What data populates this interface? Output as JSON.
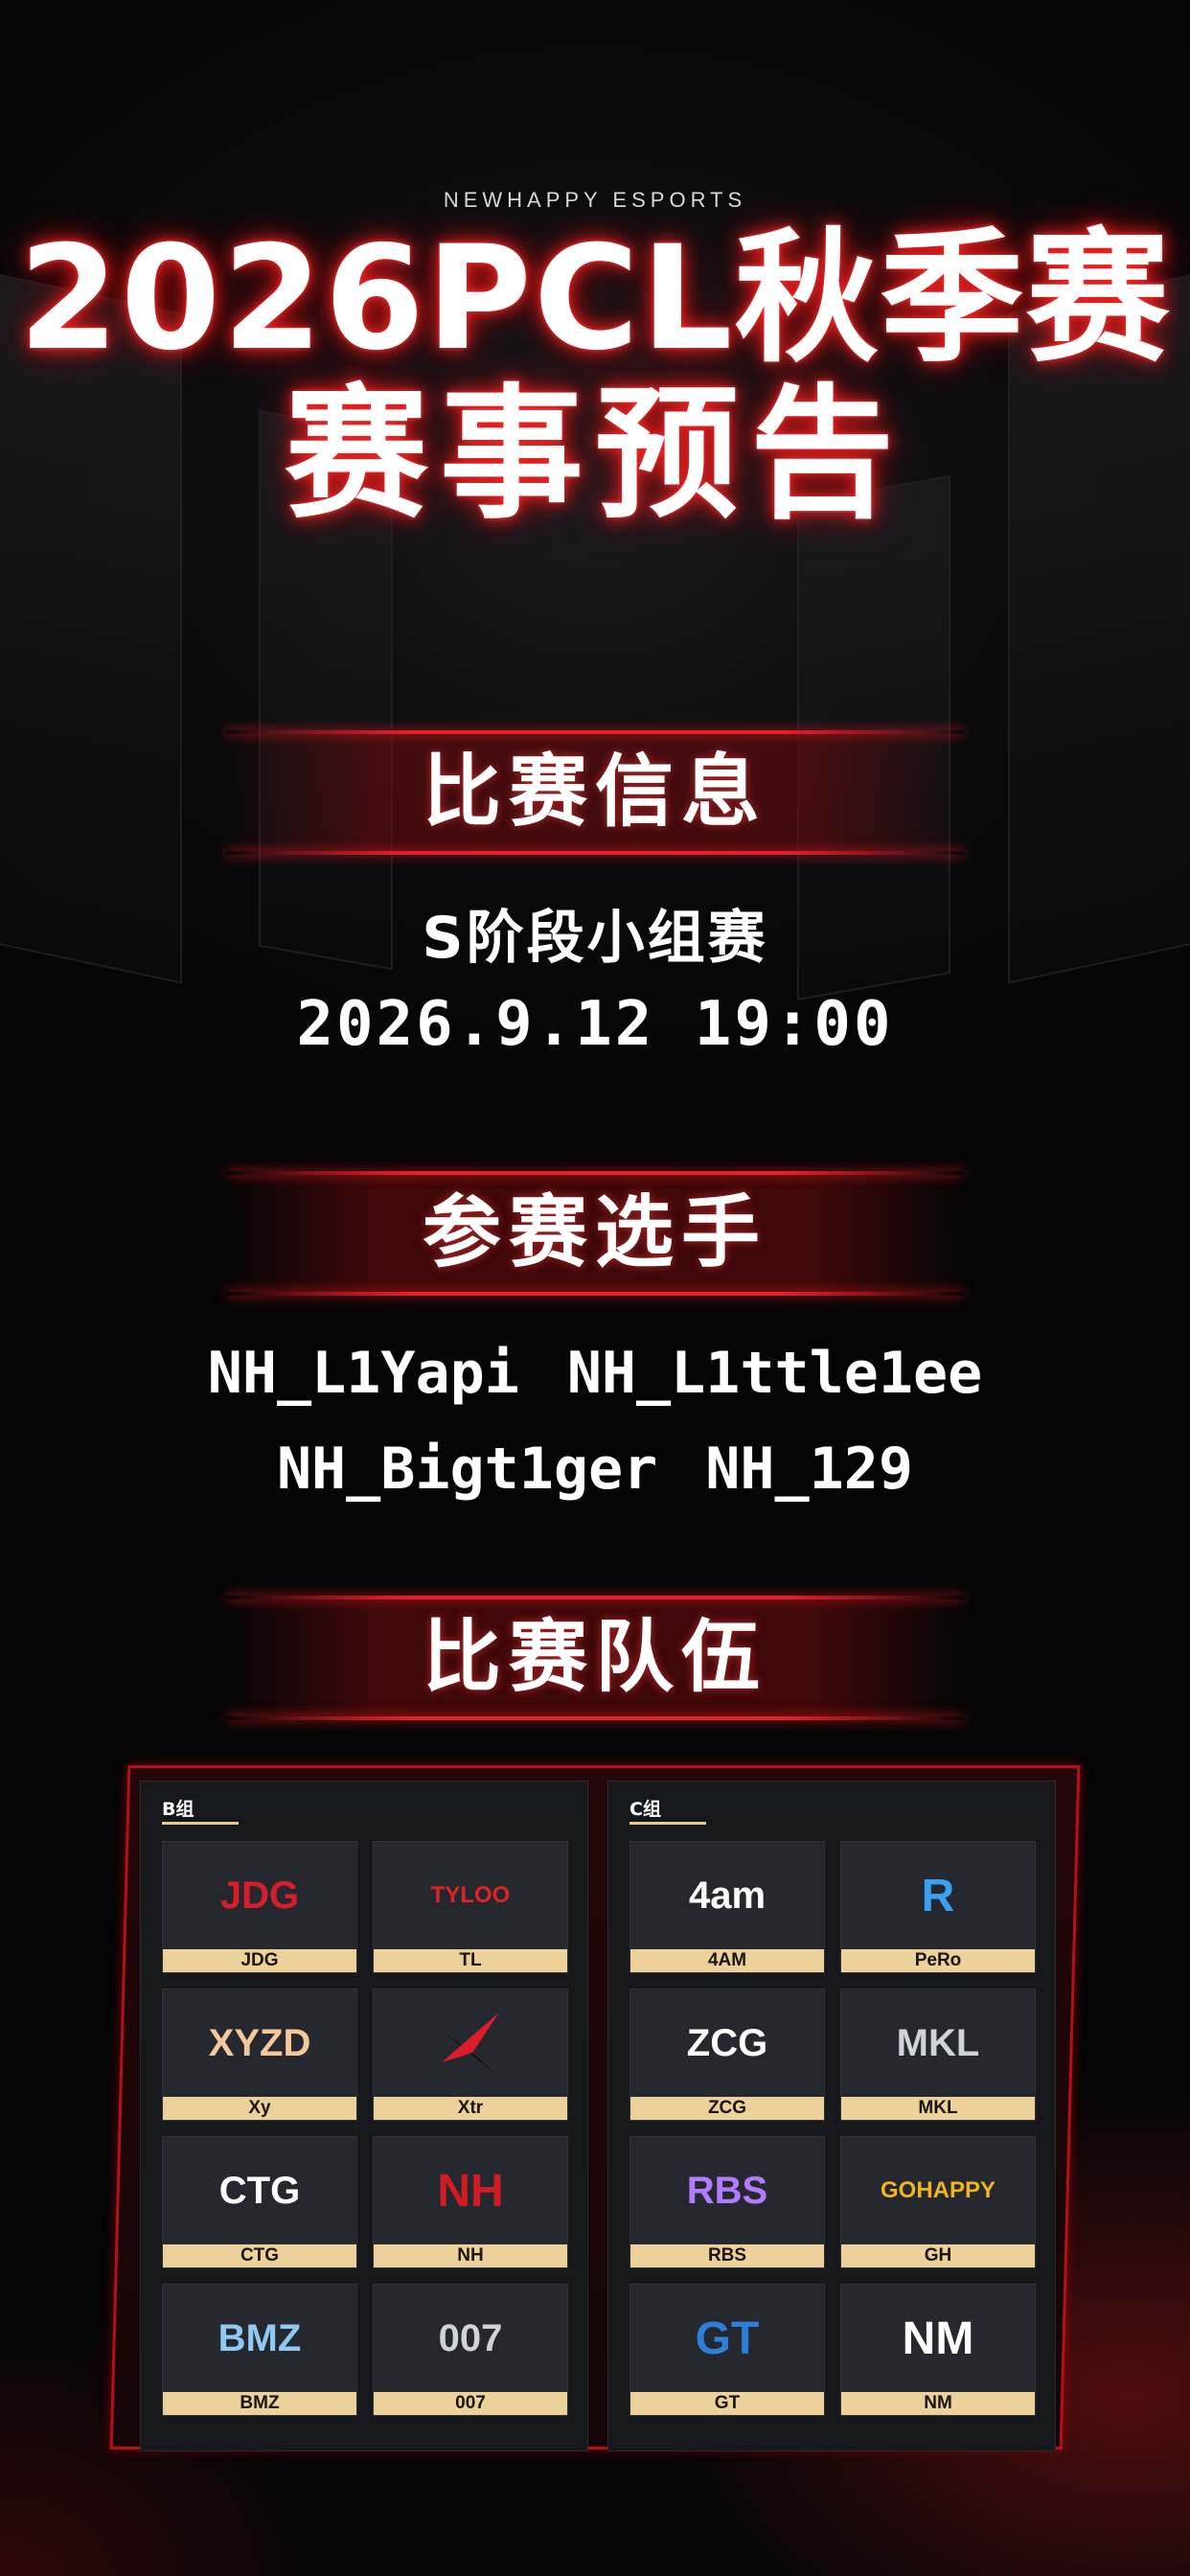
{
  "brand": "NEWHAPPY ESPORTS",
  "title_line1": "2026PCL秋季赛",
  "title_line2": "赛事预告",
  "sections": {
    "match_info": "比赛信息",
    "players": "参赛选手",
    "teams": "比赛队伍"
  },
  "match": {
    "stage": "S阶段小组赛",
    "datetime": "2026.9.12 19:00"
  },
  "players": [
    "NH_L1Yapi",
    "NH_L1ttle1ee",
    "NH_Bigt1ger",
    "NH_129"
  ],
  "groups": [
    {
      "label": "B组",
      "teams": [
        {
          "name": "JDG",
          "logo_text": "JDG",
          "logo_color": "#d81e2b"
        },
        {
          "name": "TL",
          "logo_text": "TYLOO",
          "logo_color": "#e02424"
        },
        {
          "name": "Xy",
          "logo_text": "XYZD",
          "logo_color": "#f4c89a"
        },
        {
          "name": "Xtr",
          "logo_text": "",
          "logo_color": "#e01b2b"
        },
        {
          "name": "CTG",
          "logo_text": "CTG",
          "logo_color": "#ffffff"
        },
        {
          "name": "NH",
          "logo_text": "NH",
          "logo_color": "#d01c24"
        },
        {
          "name": "BMZ",
          "logo_text": "BMZ",
          "logo_color": "#8ec9f0"
        },
        {
          "name": "007",
          "logo_text": "007",
          "logo_color": "#cfd3da"
        }
      ]
    },
    {
      "label": "C组",
      "teams": [
        {
          "name": "4AM",
          "logo_text": "4am",
          "logo_color": "#ffffff"
        },
        {
          "name": "PeRo",
          "logo_text": "R",
          "logo_color": "#3aa0f0"
        },
        {
          "name": "ZCG",
          "logo_text": "ZCG",
          "logo_color": "#ffffff"
        },
        {
          "name": "MKL",
          "logo_text": "MKL",
          "logo_color": "#cfd3da"
        },
        {
          "name": "RBS",
          "logo_text": "RBS",
          "logo_color": "#b57bff"
        },
        {
          "name": "GH",
          "logo_text": "GOHAPPY",
          "logo_color": "#f2b320"
        },
        {
          "name": "GT",
          "logo_text": "GT",
          "logo_color": "#2e7fd8"
        },
        {
          "name": "NM",
          "logo_text": "NM",
          "logo_color": "#ffffff"
        }
      ]
    }
  ],
  "colors": {
    "accent_red": "#e8202c",
    "label_gold": "#ecd29a",
    "card_bg": "#25282e"
  }
}
